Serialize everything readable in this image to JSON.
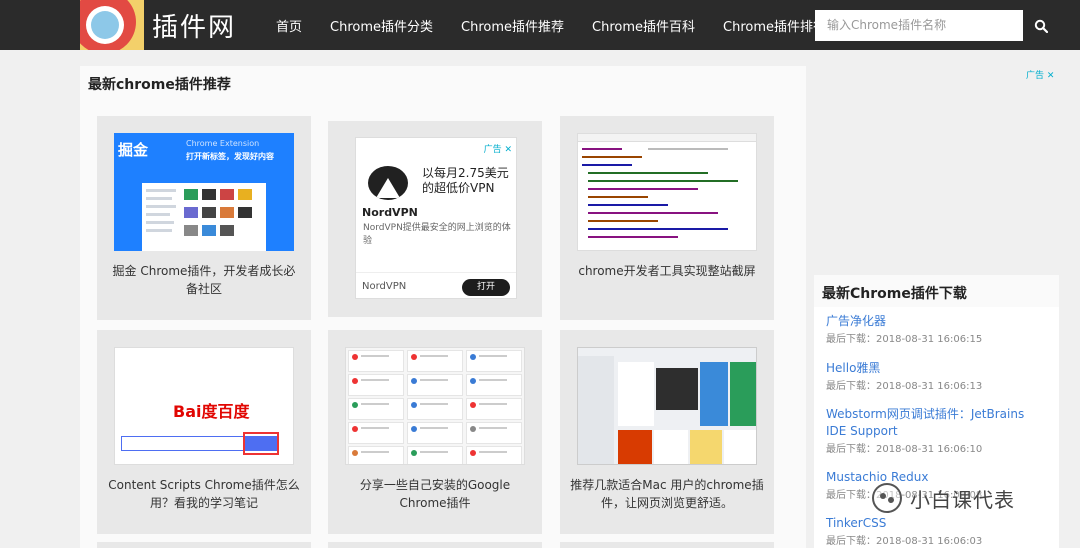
{
  "header": {
    "logo_text": "插件网",
    "nav": [
      "首页",
      "Chrome插件分类",
      "Chrome插件推荐",
      "Chrome插件百科",
      "Chrome插件排行"
    ],
    "search_placeholder": "输入Chrome插件名称"
  },
  "main": {
    "title": "最新chrome插件推荐",
    "cards": [
      {
        "caption": "掘金 Chrome插件，开发者成长必备社区",
        "thumb_logo": "掘金",
        "thumb_sub": "Chrome Extension",
        "thumb_slogan": "打开新标签，发现好内容"
      },
      {
        "caption": ""
      },
      {
        "caption": "chrome开发者工具实现整站截屏"
      },
      {
        "caption": "Content Scripts Chrome插件怎么用？看我的学习笔记",
        "thumb_logo": "Bai度百度"
      },
      {
        "caption": "分享一些自己安装的Google Chrome插件"
      },
      {
        "caption": "推荐几款适合Mac 用户的chrome插件，让网页浏览更舒适。"
      }
    ],
    "ad": {
      "tag": "广告 ✕",
      "brand": "NordVPN",
      "headline": "以每月2.75美元的超低价VPN",
      "body": "NordVPN提供最安全的网上浏览的体验",
      "footer_name": "NordVPN",
      "cta": "打开"
    }
  },
  "sidebar": {
    "ad_tag": "广告 ✕",
    "downloads_title": "最新Chrome插件下载",
    "downloads": [
      {
        "name": "广告净化器",
        "time": "最后下载：2018-08-31 16:06:15"
      },
      {
        "name": "Hello雅黑",
        "time": "最后下载：2018-08-31 16:06:13"
      },
      {
        "name": "Webstorm网页调试插件：JetBrains IDE Support",
        "time": "最后下载：2018-08-31 16:06:10"
      },
      {
        "name": "Mustachio Redux",
        "time": "最后下载：2018-08-31 16:06:08"
      },
      {
        "name": "TinkerCSS",
        "time": "最后下载：2018-08-31 16:06:03"
      }
    ]
  },
  "watermark": "小白课代表",
  "icons": {
    "search": "search-icon",
    "logo": "chrome-logo-icon"
  }
}
